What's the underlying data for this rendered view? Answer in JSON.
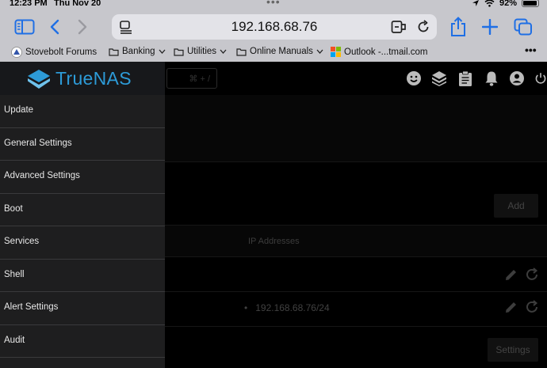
{
  "status_bar": {
    "time": "12:23 PM",
    "date": "Thu Nov 20",
    "battery": "92%"
  },
  "browser": {
    "url": "192.168.68.76",
    "bookmarks": [
      {
        "label": "Stovebolt Forums",
        "dropdown": false
      },
      {
        "label": "Banking",
        "dropdown": true
      },
      {
        "label": "Utilities",
        "dropdown": true
      },
      {
        "label": "Online Manuals",
        "dropdown": true
      },
      {
        "label": "Outlook -...tmail.com",
        "dropdown": false
      }
    ],
    "more": "•••",
    "accent_color": "#1f6fe5"
  },
  "app": {
    "brand": "TrueNAS",
    "brand_color": "#2d9bd8",
    "search_shortcut": "⌘ + /",
    "sidebar_items": [
      "Update",
      "General Settings",
      "Advanced Settings",
      "Boot",
      "Services",
      "Shell",
      "Alert Settings",
      "Audit"
    ],
    "main": {
      "add_button": "Add",
      "column_header": "IP Addresses",
      "ip_address": "192.168.68.76/24",
      "settings_button": "Settings"
    }
  }
}
